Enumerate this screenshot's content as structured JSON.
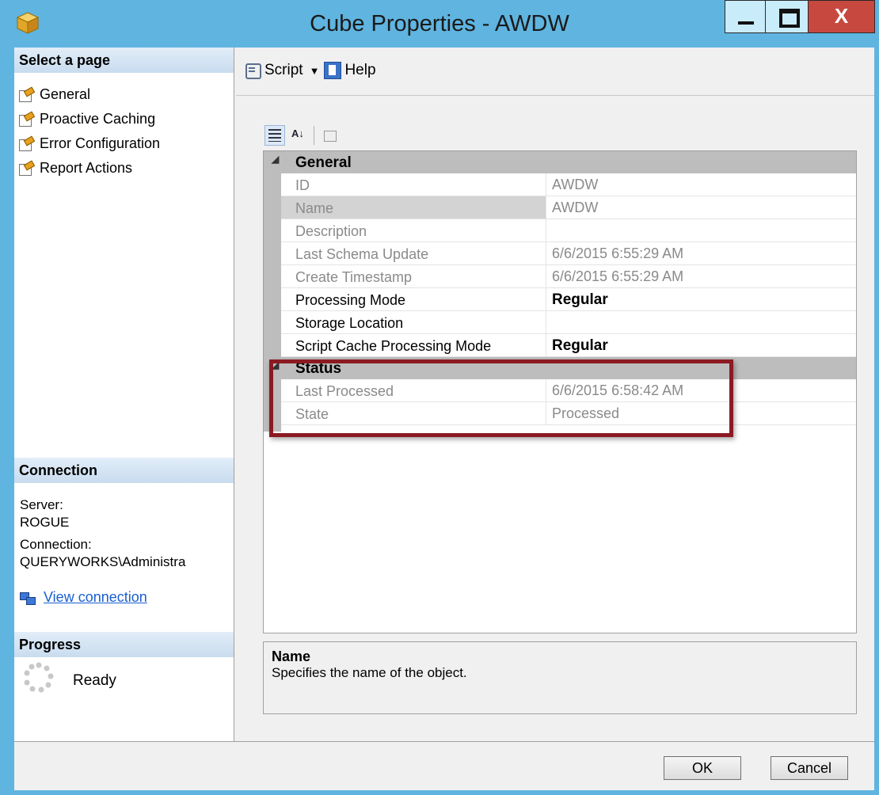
{
  "window": {
    "title": "Cube Properties - AWDW",
    "close_label": "X"
  },
  "left_pane": {
    "select_page_header": "Select a page",
    "pages": [
      {
        "label": "General"
      },
      {
        "label": "Proactive Caching"
      },
      {
        "label": "Error Configuration"
      },
      {
        "label": "Report Actions"
      }
    ],
    "connection_header": "Connection",
    "server_label": "Server:",
    "server_value": "ROGUE",
    "connection_label": "Connection:",
    "connection_value": "QUERYWORKS\\Administra",
    "view_connection_link": "View connection",
    "progress_header": "Progress",
    "progress_status": "Ready"
  },
  "toolbar": {
    "script_label": "Script",
    "help_label": "Help"
  },
  "property_grid": {
    "general_category": "General",
    "status_category": "Status",
    "general_rows": [
      {
        "name": "ID",
        "value": "AWDW"
      },
      {
        "name": "Name",
        "value": "AWDW"
      },
      {
        "name": "Description",
        "value": ""
      },
      {
        "name": "Last Schema Update",
        "value": "6/6/2015 6:55:29 AM"
      },
      {
        "name": "Create Timestamp",
        "value": "6/6/2015 6:55:29 AM"
      },
      {
        "name": "Processing Mode",
        "value": "Regular"
      },
      {
        "name": "Storage Location",
        "value": ""
      },
      {
        "name": "Script Cache Processing Mode",
        "value": "Regular"
      }
    ],
    "status_rows": [
      {
        "name": "Last Processed",
        "value": "6/6/2015 6:58:42 AM"
      },
      {
        "name": "State",
        "value": "Processed"
      }
    ]
  },
  "description_panel": {
    "title": "Name",
    "text": "Specifies the name of the object."
  },
  "buttons": {
    "ok": "OK",
    "cancel": "Cancel"
  },
  "colors": {
    "window_frame": "#5fb4e0",
    "close_button": "#c7483f",
    "highlight_box": "#8b1a22",
    "link": "#1a5fd0"
  }
}
